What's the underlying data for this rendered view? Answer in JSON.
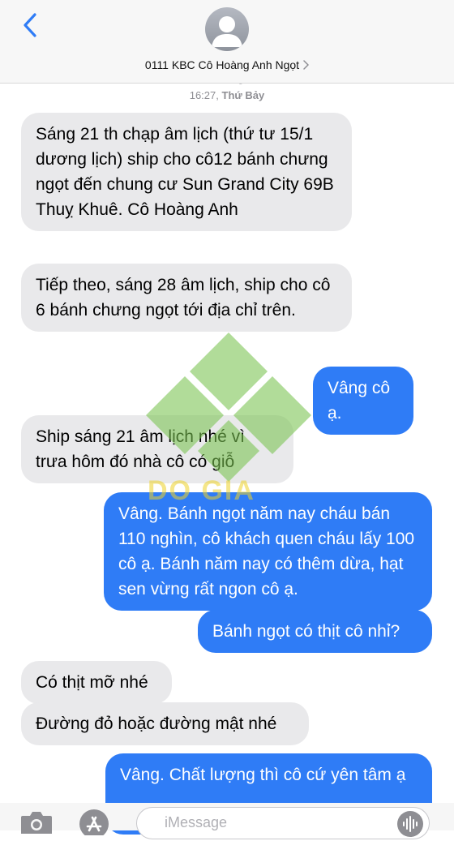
{
  "header": {
    "back_icon": "chevron-left-icon",
    "contact_name": "0111 KBC Cô Hoàng Anh Ngọt",
    "partial_label": "iMessage",
    "time": "16:27,",
    "day": "Thứ Bảy"
  },
  "messages": [
    {
      "direction": "incoming",
      "text": "Sáng 21 th chạp âm lịch (thứ tư 15/1 dương lịch) ship cho cô12 bánh chưng ngọt đến chung cư Sun Grand City 69B Thuỵ Khuê. Cô Hoàng Anh"
    },
    {
      "direction": "incoming",
      "text": "Tiếp theo, sáng 28 âm lịch, ship cho cô 6 bánh chưng ngọt tới địa chỉ trên."
    },
    {
      "direction": "outgoing",
      "text": "Vâng cô ạ."
    },
    {
      "direction": "incoming",
      "text": "Ship sáng 21 âm lịch nhé vì trưa hôm đó nhà cô có giỗ"
    },
    {
      "direction": "outgoing",
      "text": "Vâng. Bánh ngọt năm nay cháu bán 110 nghìn, cô khách quen cháu lấy 100 cô ạ. Bánh năm nay có thêm dừa, hạt sen vừng rất ngon cô ạ."
    },
    {
      "direction": "outgoing",
      "text": "Bánh ngọt có thịt cô nhỉ?"
    },
    {
      "direction": "incoming",
      "text": "Có thịt mỡ nhé"
    },
    {
      "direction": "incoming",
      "text": "Đường đỏ hoặc đường mật nhé"
    },
    {
      "direction": "outgoing",
      "text": "Vâng. Chất lượng thì cô cứ yên tâm ạ"
    }
  ],
  "watermark": {
    "brand": "DO GIA"
  },
  "composer": {
    "placeholder": "iMessage"
  },
  "colors": {
    "outgoing": "#2f7cf6",
    "incoming": "#e9e9eb",
    "accent": "#2f7cf6"
  }
}
